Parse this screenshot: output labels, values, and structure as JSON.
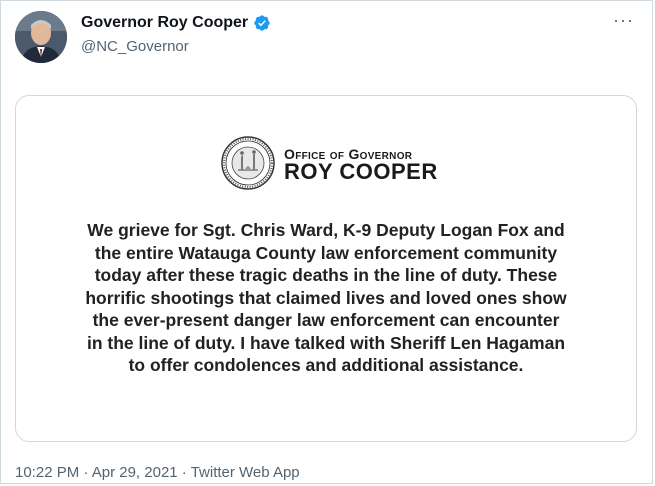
{
  "author": {
    "display_name": "Governor Roy Cooper",
    "handle": "@NC_Governor",
    "verified_badge_color": "#1d9bf0"
  },
  "more_glyph": "···",
  "card": {
    "office_line": "Office of Governor",
    "office_name": "ROY COOPER",
    "statement_lines": [
      "We grieve for Sgt. Chris Ward, K-9 Deputy Logan Fox and",
      "the entire Watauga County law enforcement community",
      "today after these tragic deaths in the line of duty. These",
      "horrific shootings that claimed lives and loved ones show",
      "the ever-present danger law enforcement can encounter",
      "in the line of duty. I have talked with Sheriff Len Hagaman",
      "to offer condolences and additional assistance."
    ]
  },
  "meta": {
    "time": "10:22 PM",
    "date": "Apr 29, 2021",
    "source": "Twitter Web App",
    "separator": " · "
  }
}
